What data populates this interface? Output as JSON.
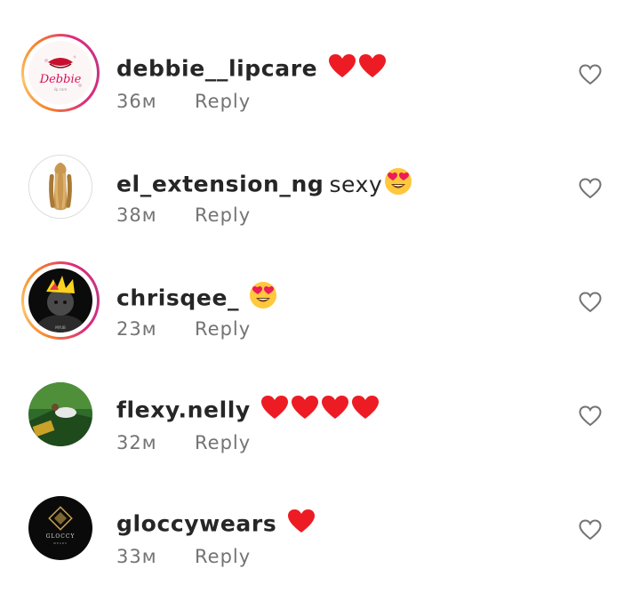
{
  "comments": [
    {
      "username": "debbie__lipcare",
      "text": "",
      "time": "36м",
      "reply": "Reply",
      "emoji": [
        "red-heart",
        "red-heart"
      ],
      "story_ring": true
    },
    {
      "username": "el_extension_ng",
      "text": "sexy",
      "time": "38м",
      "reply": "Reply",
      "emoji": [
        "heart-eyes"
      ],
      "story_ring": false
    },
    {
      "username": "chrisqee_",
      "text": "",
      "time": "23м",
      "reply": "Reply",
      "emoji": [
        "heart-eyes"
      ],
      "story_ring": true
    },
    {
      "username": "flexy.nelly",
      "text": "",
      "time": "32м",
      "reply": "Reply",
      "emoji": [
        "red-heart",
        "red-heart",
        "red-heart",
        "red-heart"
      ],
      "story_ring": false
    },
    {
      "username": "gloccywears",
      "text": "",
      "time": "33м",
      "reply": "Reply",
      "emoji": [
        "red-heart"
      ],
      "story_ring": false
    }
  ],
  "avatar_labels": {
    "debbie": "Debbie",
    "debbie_sub": "lip care",
    "gloccy": "GLOCCY",
    "gloccy_sub": "WEARS",
    "chris": "MYUB"
  },
  "colors": {
    "text": "#262626",
    "meta": "#737373",
    "heart_red": "#ed1c24",
    "story_ring_orange": "#f58529",
    "story_ring_pink": "#dd2a7b"
  }
}
